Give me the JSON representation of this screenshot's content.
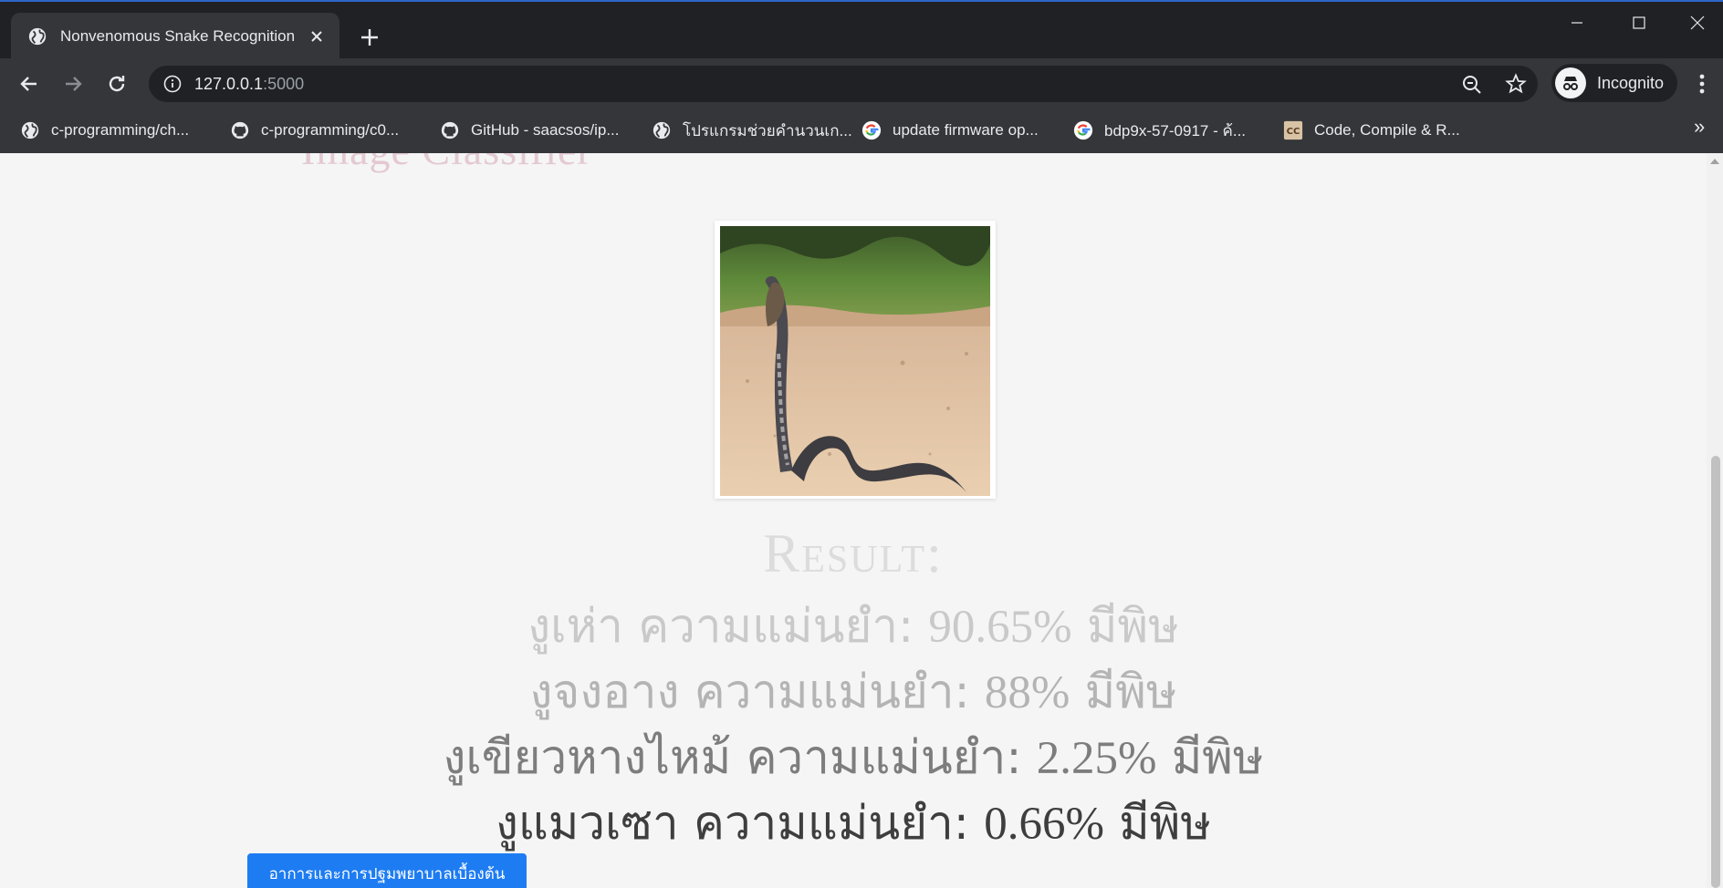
{
  "browser": {
    "tab_title": "Nonvenomous Snake Recognition",
    "url_host": "127.0.0.1",
    "url_port": ":5000",
    "profile_label": "Incognito",
    "bookmarks": [
      {
        "label": "c-programming/ch...",
        "icon": "globe-icon"
      },
      {
        "label": "c-programming/c0...",
        "icon": "github-icon"
      },
      {
        "label": "GitHub - saacsos/ip...",
        "icon": "github-icon"
      },
      {
        "label": "โปรแกรมช่วยคำนวนเก...",
        "icon": "globe-icon"
      },
      {
        "label": "update firmware op...",
        "icon": "google-icon"
      },
      {
        "label": "bdp9x-57-0917 - ค้...",
        "icon": "google-icon"
      },
      {
        "label": "Code, Compile & R...",
        "icon": "cc-icon"
      }
    ],
    "bookmarks_more": "»"
  },
  "page": {
    "brand_partial": "Image Classifier",
    "result_heading": "Result:",
    "results": [
      {
        "name": "งูเห่า",
        "label": "ความแม่นยำ:",
        "confidence": "90.65%",
        "status": "มีพิษ"
      },
      {
        "name": "งูจงอาง",
        "label": "ความแม่นยำ:",
        "confidence": "88%",
        "status": "มีพิษ"
      },
      {
        "name": "งูเขียวหางไหม้",
        "label": "ความแม่นยำ:",
        "confidence": "2.25%",
        "status": "มีพิษ"
      },
      {
        "name": "งูแมวเซา",
        "label": "ความแม่นยำ:",
        "confidence": "0.66%",
        "status": "มีพิษ"
      }
    ],
    "first_aid_button": "อาการและการปฐมพยาบาลเบื้องต้น"
  }
}
